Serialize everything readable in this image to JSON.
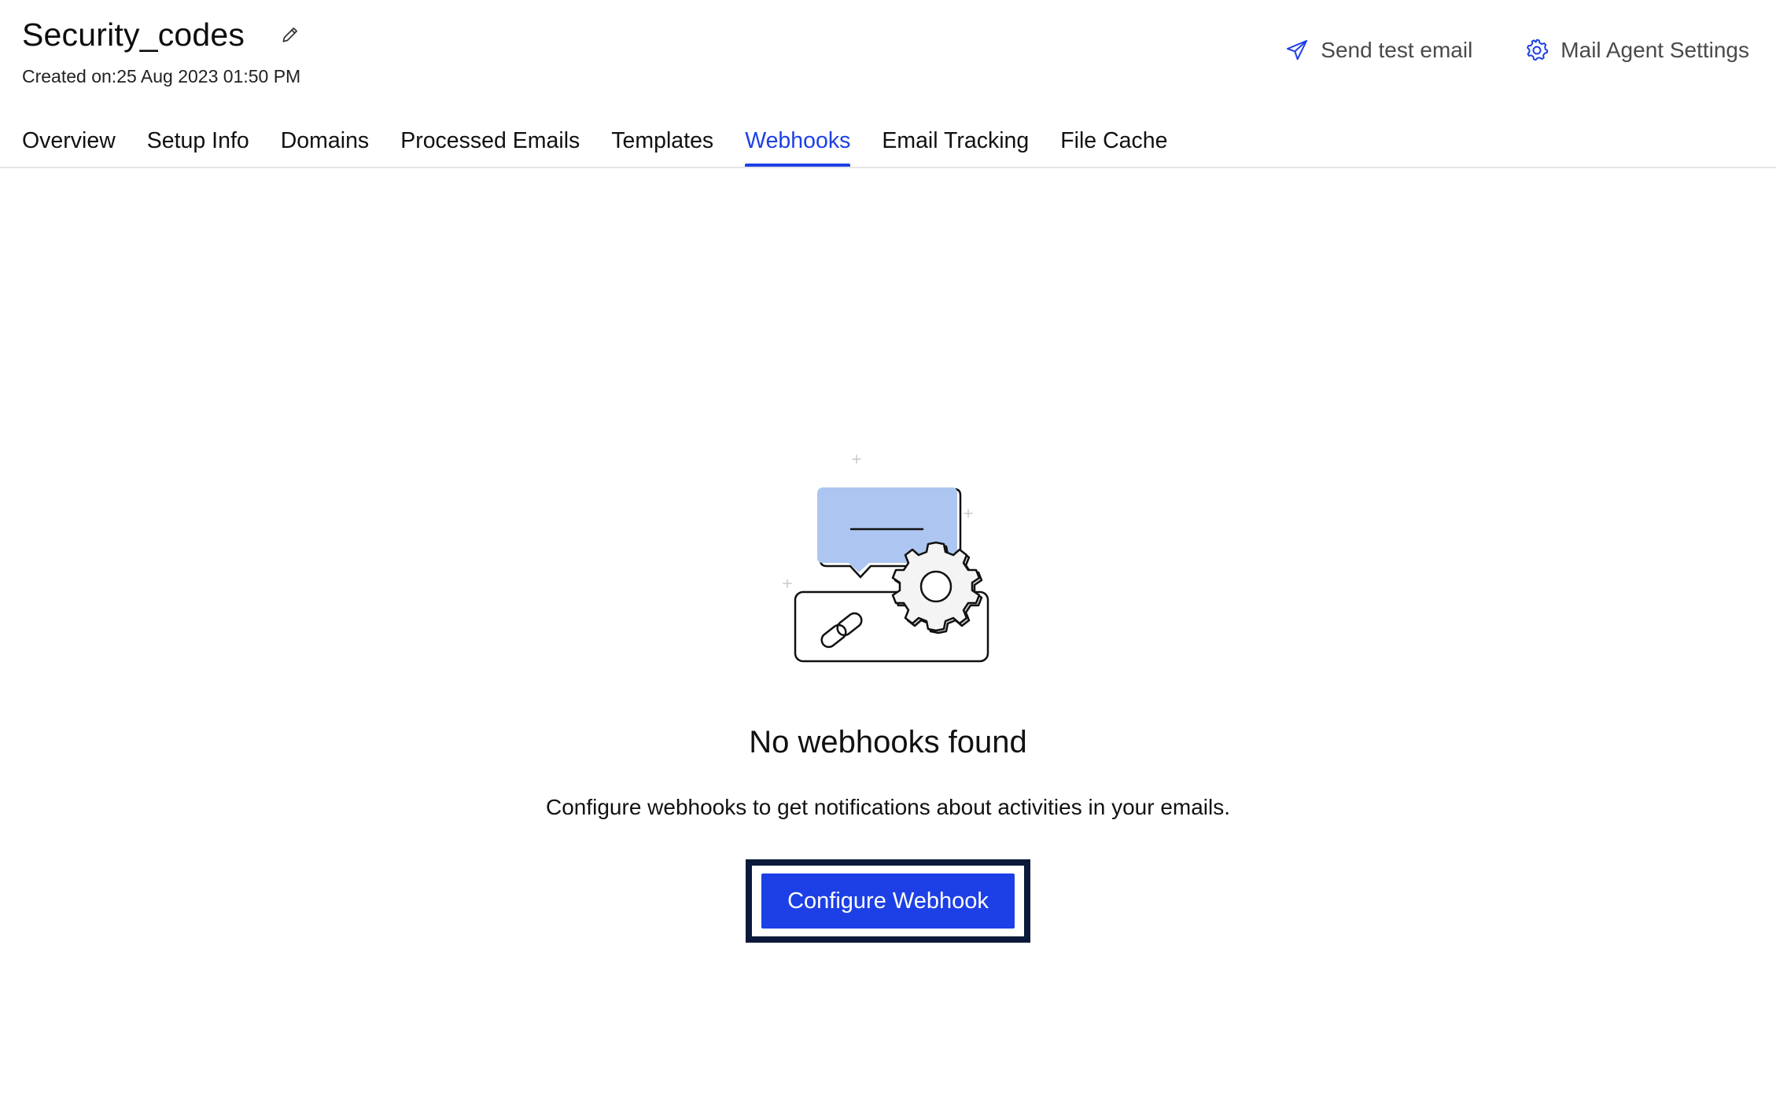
{
  "header": {
    "title": "Security_codes",
    "created_on": "Created on:25 Aug 2023 01:50 PM",
    "actions": {
      "send_test_email": "Send test email",
      "mail_agent_settings": "Mail Agent Settings"
    }
  },
  "tabs": [
    {
      "label": "Overview",
      "active": false
    },
    {
      "label": "Setup Info",
      "active": false
    },
    {
      "label": "Domains",
      "active": false
    },
    {
      "label": "Processed Emails",
      "active": false
    },
    {
      "label": "Templates",
      "active": false
    },
    {
      "label": "Webhooks",
      "active": true
    },
    {
      "label": "Email Tracking",
      "active": false
    },
    {
      "label": "File Cache",
      "active": false
    }
  ],
  "empty_state": {
    "title": "No webhooks found",
    "description": "Configure webhooks to get notifications about activities in your emails.",
    "button_label": "Configure Webhook"
  },
  "icons": {
    "edit": "pencil-icon",
    "send": "paper-plane-icon",
    "settings": "gear-icon"
  },
  "colors": {
    "accent": "#1d40e6",
    "active_tab": "#1d40e6",
    "focus_frame": "#0c1a3a",
    "illustration_bubble": "#adc6f1"
  }
}
